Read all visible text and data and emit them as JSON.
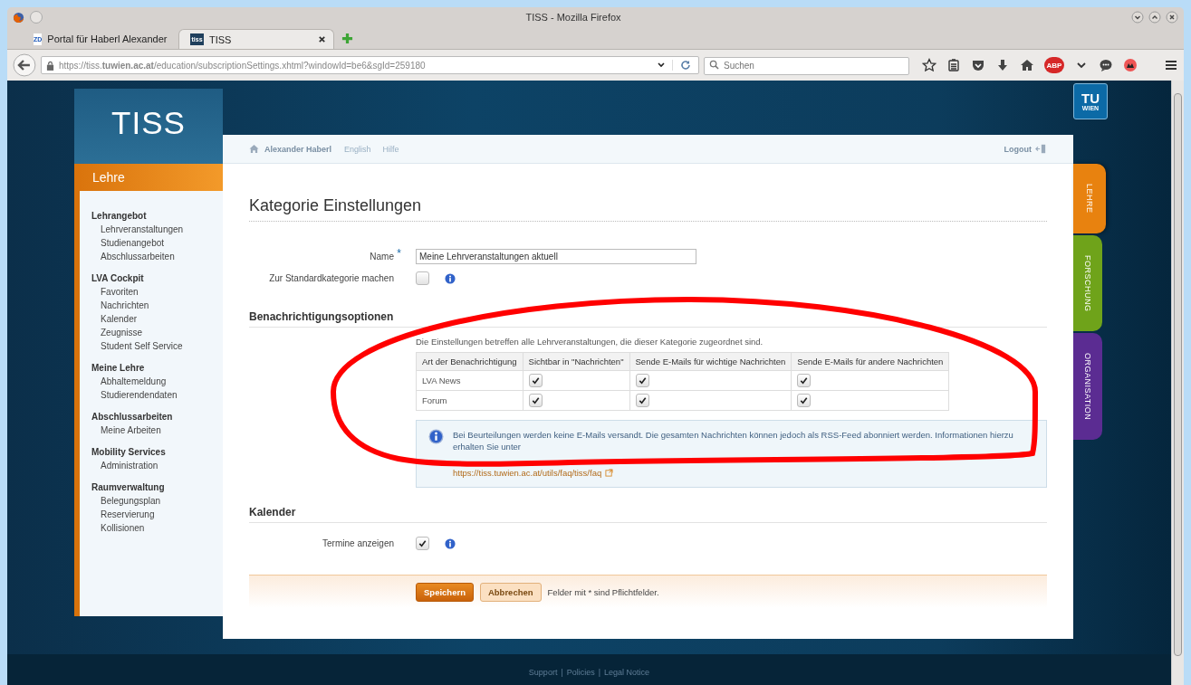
{
  "browser": {
    "window_title": "TISS - Mozilla Firefox",
    "tabs": [
      {
        "label": "Portal für Haberl Alexander",
        "favicon": "ZD",
        "selected": false
      },
      {
        "label": "TISS",
        "favicon": "tiss",
        "selected": true
      }
    ],
    "url": "https://tiss.**tuwien.ac.at**/education/subscriptionSettings.xhtml?windowId=be6&sgId=259180",
    "search": {
      "placeholder": "Suchen"
    },
    "adblock_label": "ABP"
  },
  "page": {
    "logo": "TISS",
    "tu_logo": {
      "top": "TU",
      "bottom": "WIEN"
    },
    "sidebar": {
      "title": "Lehre",
      "groups": [
        {
          "heading": "Lehrangebot",
          "items": [
            "Lehrveranstaltungen",
            "Studienangebot",
            "Abschlussarbeiten"
          ]
        },
        {
          "heading": "LVA Cockpit",
          "items": [
            "Favoriten",
            "Nachrichten",
            "Kalender",
            "Zeugnisse",
            "Student Self Service"
          ]
        },
        {
          "heading": "Meine Lehre",
          "items": [
            "Abhaltemeldung",
            "Studierendendaten"
          ]
        },
        {
          "heading": "Abschlussarbeiten",
          "items": [
            "Meine Arbeiten"
          ]
        },
        {
          "heading": "Mobility Services",
          "items": [
            "Administration"
          ]
        },
        {
          "heading": "Raumverwaltung",
          "items": [
            "Belegungsplan",
            "Reservierung",
            "Kollisionen"
          ]
        }
      ]
    },
    "side_tabs": [
      {
        "label": "LEHRE",
        "color": "#e8820f",
        "selected": true
      },
      {
        "label": "FORSCHUNG",
        "color": "#6fa31a",
        "selected": false
      },
      {
        "label": "ORGANISATION",
        "color": "#5b2c92",
        "selected": false
      }
    ],
    "topnav": {
      "user": "Alexander Haberl",
      "links": [
        "English",
        "Hilfe"
      ],
      "logout": "Logout"
    },
    "heading": "Kategorie Einstellungen",
    "form": {
      "required_mark": "*",
      "fields": [
        {
          "kind": "text",
          "label": "Name",
          "required": true,
          "info": false,
          "value": "Meine Lehrveranstaltungen aktuell"
        },
        {
          "kind": "checkbox",
          "label": "Zur Standardkategorie machen",
          "required": false,
          "checked": false,
          "info": true
        }
      ]
    },
    "notifications": {
      "title": "Benachrichtigungsoptionen",
      "description": "Die Einstellungen betreffen alle Lehrveranstaltungen, die dieser Kategorie zugeordnet sind.",
      "columns": [
        "Art der Benachrichtigung",
        "Sichtbar in \"Nachrichten\"",
        "Sende E-Mails für wichtige Nachrichten",
        "Sende E-Mails für andere Nachrichten"
      ],
      "rows": [
        {
          "label": "LVA News",
          "checks": [
            true,
            true,
            true
          ]
        },
        {
          "label": "Forum",
          "checks": [
            true,
            true,
            true
          ]
        }
      ],
      "info": {
        "text": "Bei Beurteilungen werden keine E-Mails versandt. Die gesamten Nachrichten können jedoch als RSS-Feed abonniert werden. Informationen hierzu erhalten Sie unter",
        "link": "https://tiss.tuwien.ac.at/utils/faq/tiss/faq"
      }
    },
    "calendar": {
      "title": "Kalender",
      "fields": [
        {
          "kind": "checkbox",
          "label": "Termine anzeigen",
          "required": false,
          "checked": true,
          "info": true
        }
      ]
    },
    "actions": {
      "buttons": [
        {
          "label": "Speichern",
          "kind": "primary"
        },
        {
          "label": "Abbrechen",
          "kind": "secondary"
        }
      ],
      "note": "Felder mit * sind Pflichtfelder."
    },
    "footer": {
      "links": [
        "Support",
        "Policies",
        "Legal Notice"
      ],
      "separator": "|"
    }
  }
}
